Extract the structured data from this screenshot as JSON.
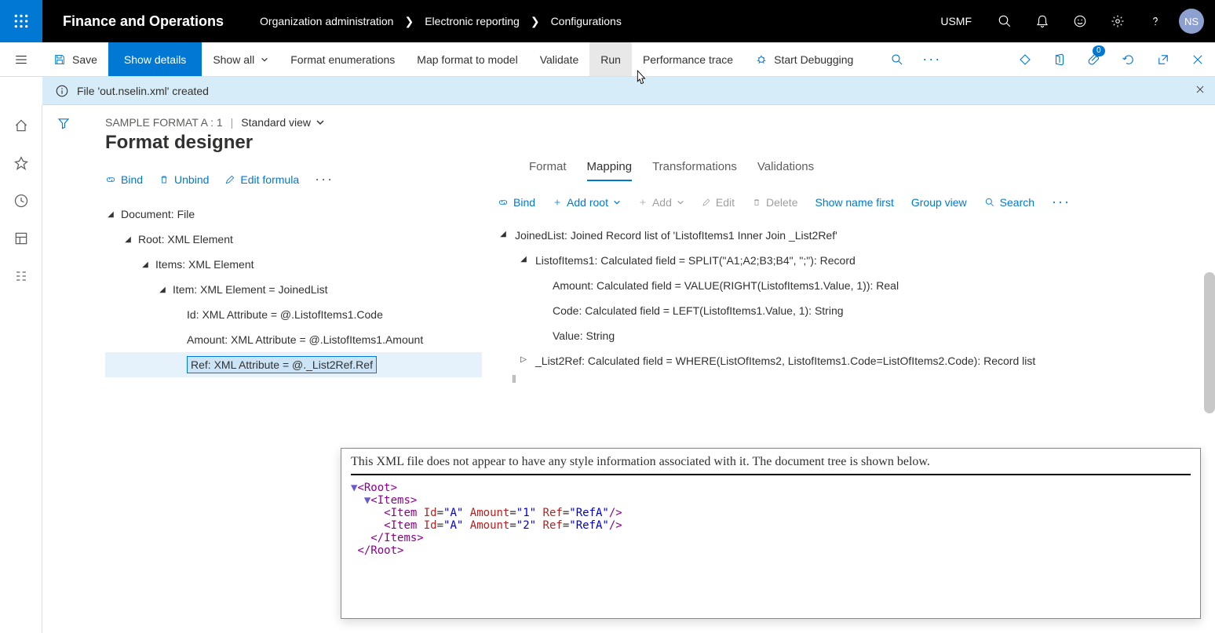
{
  "topbar": {
    "app_title": "Finance and Operations",
    "breadcrumb": [
      "Organization administration",
      "Electronic reporting",
      "Configurations"
    ],
    "company": "USMF",
    "avatar_initials": "NS",
    "attach_badge": "0"
  },
  "actionbar": {
    "save": "Save",
    "show_details": "Show details",
    "show_all": "Show all",
    "format_enum": "Format enumerations",
    "map_format": "Map format to model",
    "validate": "Validate",
    "run": "Run",
    "perf_trace": "Performance trace",
    "start_debug": "Start Debugging"
  },
  "message": "File 'out.nselin.xml' created",
  "header": {
    "breadcrumb1": "SAMPLE FORMAT A : 1",
    "view": "Standard view",
    "title": "Format designer"
  },
  "left_tools": {
    "bind": "Bind",
    "unbind": "Unbind",
    "edit": "Edit formula"
  },
  "right_tabs": {
    "format": "Format",
    "mapping": "Mapping",
    "transform": "Transformations",
    "valid": "Validations"
  },
  "map_tools": {
    "bind": "Bind",
    "addroot": "Add root",
    "add": "Add",
    "edit": "Edit",
    "delete": "Delete",
    "show_name": "Show name first",
    "group": "Group view",
    "search": "Search"
  },
  "format_tree": {
    "doc": "Document: File",
    "root": "Root: XML Element",
    "items": "Items: XML Element",
    "item": "Item: XML Element = JoinedList",
    "id": "Id: XML Attribute = @.ListofItems1.Code",
    "amount": "Amount: XML Attribute = @.ListofItems1.Amount",
    "ref": "Ref: XML Attribute = @._List2Ref.Ref"
  },
  "mapping_tree": {
    "joined": "JoinedList: Joined Record list of 'ListofItems1 Inner Join _List2Ref'",
    "list1": "ListofItems1: Calculated field = SPLIT(\"A1;A2;B3;B4\", \";\"): Record",
    "amount": "Amount: Calculated field = VALUE(RIGHT(ListofItems1.Value, 1)): Real",
    "code": "Code: Calculated field = LEFT(ListofItems1.Value, 1): String",
    "value": "Value: String",
    "list2": "_List2Ref: Calculated field = WHERE(ListOfItems2, ListofItems1.Code=ListOfItems2.Code): Record list"
  },
  "xml": {
    "message": "This XML file does not appear to have any style information associated with it. The document tree is shown below."
  }
}
